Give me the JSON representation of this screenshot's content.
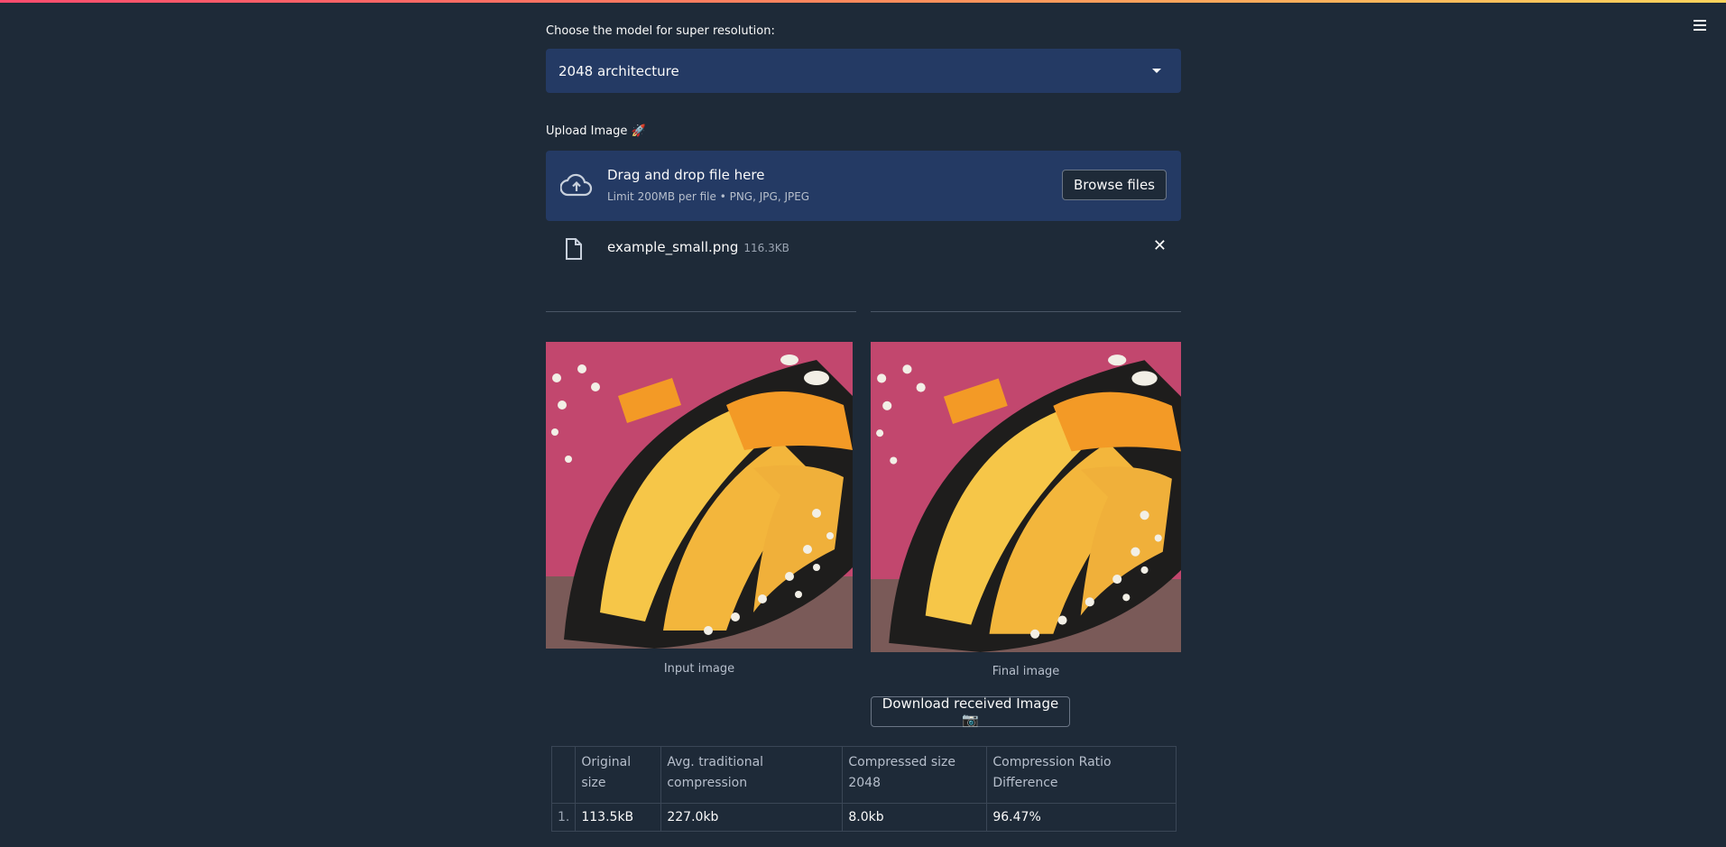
{
  "model_select": {
    "label": "Choose the model for super resolution:",
    "value": "2048 architecture"
  },
  "upload": {
    "label": "Upload Image 🚀",
    "dropzone_title": "Drag and drop file here",
    "dropzone_subtitle": "Limit 200MB per file • PNG, JPG, JPEG",
    "browse_label": "Browse files",
    "file_name": "example_small.png",
    "file_size": "116.3KB"
  },
  "images": {
    "input_caption": "Input image",
    "final_caption": "Final image"
  },
  "download_label": "Download received Image 📷",
  "table": {
    "headers": [
      "",
      "Original size",
      "Avg. traditional compression",
      "Compressed size 2048",
      "Compression Ratio Difference"
    ],
    "rows": [
      [
        "1.",
        "113.5kB",
        "227.0kb",
        "8.0kb",
        "96.47%"
      ]
    ]
  },
  "colors": {
    "background": "#1e2a38",
    "widget": "#243a64",
    "accent": "#ff4b6e"
  },
  "icons": {
    "menu": "hamburger-icon",
    "upload": "cloud-upload-icon",
    "file": "file-icon",
    "remove": "close-icon",
    "caret": "caret-down-icon"
  }
}
